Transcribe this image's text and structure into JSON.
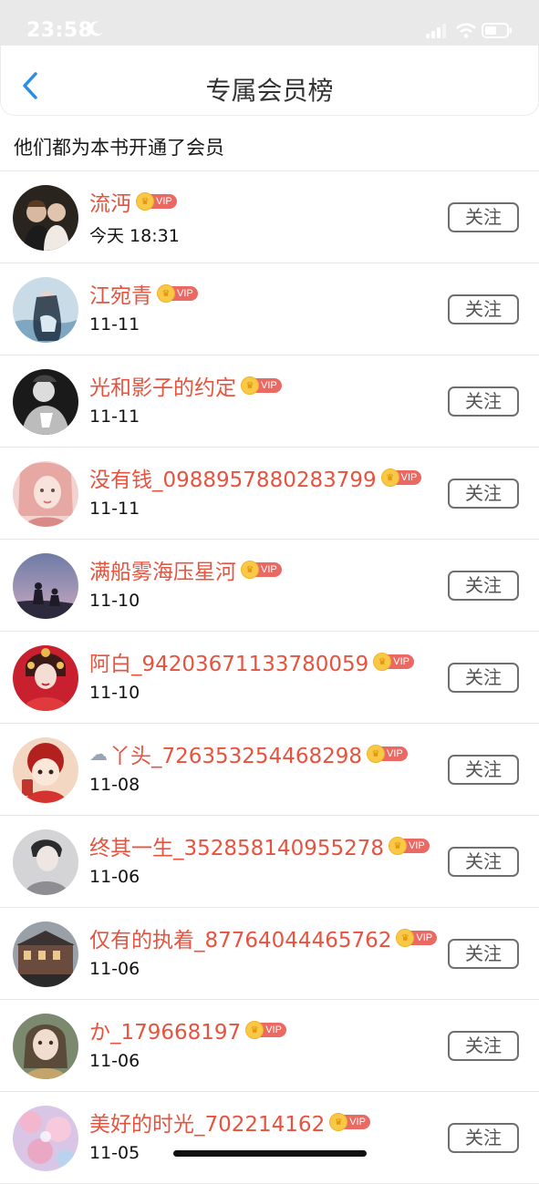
{
  "status": {
    "time": "23:58"
  },
  "header": {
    "title": "专属会员榜"
  },
  "subtitle": "他们都为本书开通了会员",
  "vip_label": "VIP",
  "follow_label": "关注",
  "members": [
    {
      "name": "流沔",
      "date": "今天 18:31",
      "prefix_icon": ""
    },
    {
      "name": "江宛青",
      "date": "11-11",
      "prefix_icon": ""
    },
    {
      "name": "光和影子的约定",
      "date": "11-11",
      "prefix_icon": ""
    },
    {
      "name": "没有钱_0988957880283799",
      "date": "11-11",
      "prefix_icon": ""
    },
    {
      "name": "满船雾海压星河",
      "date": "11-10",
      "prefix_icon": ""
    },
    {
      "name": "阿白_94203671133780059",
      "date": "11-10",
      "prefix_icon": ""
    },
    {
      "name": "丫头_726353254468298",
      "date": "11-08",
      "prefix_icon": "cloud-icon"
    },
    {
      "name": "终其一生_352858140955278",
      "date": "11-06",
      "prefix_icon": ""
    },
    {
      "name": "仅有的执着_87764044465762",
      "date": "11-06",
      "prefix_icon": ""
    },
    {
      "name": "か_179668197",
      "date": "11-06",
      "prefix_icon": ""
    },
    {
      "name": "美好的时光_702214162",
      "date": "11-05",
      "prefix_icon": ""
    }
  ],
  "colors": {
    "name": "#e6533f",
    "vip_tag": "#ea6a63",
    "crown": "#f9c846",
    "back_arrow": "#2a8fe0"
  }
}
